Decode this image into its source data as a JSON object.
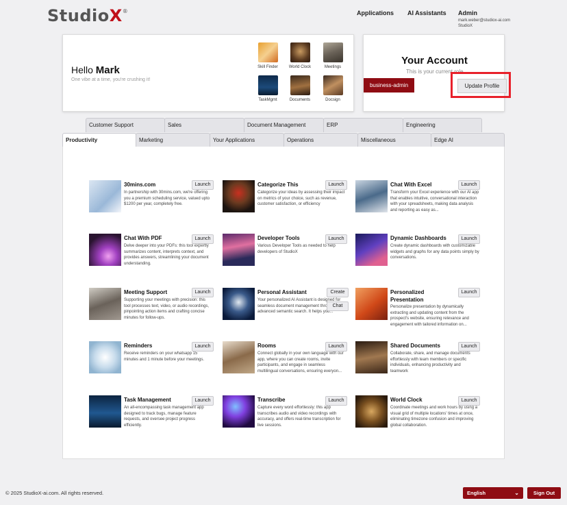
{
  "header": {
    "logo_main": "Studio",
    "logo_x": "X",
    "logo_reg": "®",
    "nav": {
      "applications": "Applications",
      "ai_assistants": "AI Assistants",
      "admin": "Admin",
      "email": "mark.weber@studiox-ai.com",
      "org": "StudioX"
    }
  },
  "hello": {
    "greeting": "Hello",
    "name": "Mark",
    "subtitle": "One vibe at a time, you're crushing it!",
    "quick_apps": [
      "Skill Finder",
      "World Clock",
      "Meetings",
      "TaskMgmt",
      "Documents",
      "Docsign"
    ]
  },
  "account": {
    "title": "Your Account",
    "subtitle": "This is your current role",
    "role": "business-admin",
    "update_label": "Update Profile"
  },
  "tabs_row1": [
    "Customer Support",
    "Sales",
    "Document Management",
    "ERP",
    "Engineering"
  ],
  "tabs_row2": [
    "Productivity",
    "Marketing",
    "Your Applications",
    "Operations",
    "Miscellaneous",
    "Edge AI"
  ],
  "apps": [
    {
      "name": "30mins.com",
      "desc": "In partnership with 30mins.com, we're offering you a premium scheduling service, valued upto $1200 per year, completely free.",
      "buttons": [
        "Launch"
      ]
    },
    {
      "name": "Categorize This",
      "desc": "Categorize your ideas by assessing their impact on metrics of your choice, such as revenue, customer satisfaction, or efficiency",
      "buttons": [
        "Launch"
      ]
    },
    {
      "name": "Chat With Excel",
      "desc": "Transform your Excel experience with our AI app that enables intuitive, conversational interaction with your spreadsheets, making data analysis and reporting as easy as...",
      "buttons": [
        "Launch"
      ]
    },
    {
      "name": "Chat With PDF",
      "desc": "Delve deeper into your PDFs: this tool expertly summarizes content, interprets context, and provides answers, streamlining your document understanding.",
      "buttons": [
        "Launch"
      ]
    },
    {
      "name": "Developer Tools",
      "desc": "Various Developer Tools as needed to help developers of StudioX",
      "buttons": [
        "Launch"
      ]
    },
    {
      "name": "Dynamic Dashboards",
      "desc": "Create dynamic dashboards with customizable widgets and graphs for any data points simply by conversations.",
      "buttons": [
        "Launch"
      ]
    },
    {
      "name": "Meeting Support",
      "desc": "Supporting your meetings with precision: this tool processes text, video, or audio recordings, pinpointing action items and crafting concise minutes for follow-ups.",
      "buttons": [
        "Launch"
      ]
    },
    {
      "name": "Personal Assistant",
      "desc": "Your personalized AI Assistant is designed for seamless document management through advanced semantic search. It helps you...",
      "buttons": [
        "Create",
        "Chat"
      ]
    },
    {
      "name": "Personalized Presentation",
      "desc": "Personalize presentation by dynamically extracting and updating content from the prospect's website, ensuring relevance and engagement with tailored information on...",
      "buttons": [
        "Launch"
      ]
    },
    {
      "name": "Reminders",
      "desc": "Receive reminders on your whatsapp 15 minutes and 1 minute before your meetings.",
      "buttons": [
        "Launch"
      ]
    },
    {
      "name": "Rooms",
      "desc": "Connect globally in your own language with our app, where you can create rooms, invite participants, and engage in seamless multilingual conversations, ensuring everyon...",
      "buttons": [
        "Launch"
      ]
    },
    {
      "name": "Shared Documents",
      "desc": "Collaborate, share, and manage documents effortlessly with team members or specific individuals, enhancing productivity and teamwork",
      "buttons": [
        "Launch"
      ]
    },
    {
      "name": "Task Management",
      "desc": "An all-encompassing task management app designed to track bugs, manage feature requests, and oversee project progress efficiently.",
      "buttons": [
        "Launch"
      ]
    },
    {
      "name": "Transcribe",
      "desc": "Capture every word effortlessly: this app transcribes audio and video recordings with accuracy, and offers real-time transcription for live sessions.",
      "buttons": [
        "Launch"
      ]
    },
    {
      "name": "World Clock",
      "desc": "Coordinate meetings and work hours by using a visual grid of multiple locations' times at once, eliminating timezone confusion and improving global collaboration.",
      "buttons": [
        "Launch"
      ]
    }
  ],
  "footer": {
    "copyright": "© 2025 StudioX-ai.com.  All rights reserved.",
    "language": "English",
    "caret": "⌄",
    "signout": "Sign Out"
  }
}
